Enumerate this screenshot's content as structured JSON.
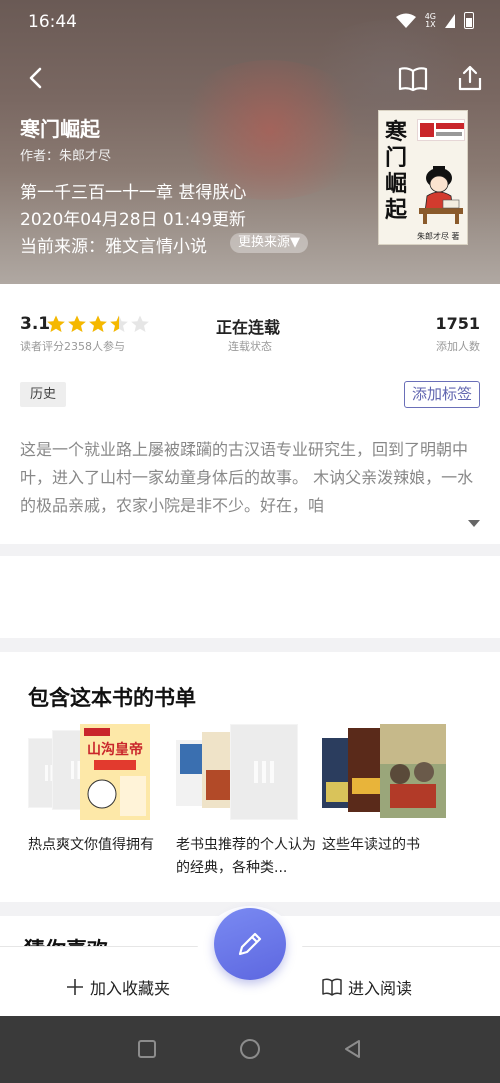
{
  "status_bar": {
    "time": "16:44",
    "network_top": "4G",
    "network_bottom": "1X"
  },
  "book": {
    "title": "寒门崛起",
    "author": "作者：朱郎才尽",
    "latest_chapter": "第一千三百一十一章 甚得朕心",
    "updated_at": "2020年04月28日 01:49更新",
    "source": "当前来源：雅文言情小说",
    "switch_source": "更换来源▼",
    "cover_title_chars": [
      "寒",
      "门",
      "崛",
      "起"
    ],
    "cover_signature": "朱郎才尽 著"
  },
  "stats": {
    "rating": "3.1",
    "stars_filled": 3.5,
    "stars_total": 5,
    "rating_caption": "读者评分2358人参与",
    "status": "正在连载",
    "status_caption": "连载状态",
    "adds": "1751",
    "adds_caption": "添加人数"
  },
  "tags": {
    "history": "历史",
    "add_tag": "添加标签"
  },
  "synopsis": "这是一个就业路上屡被蹂躏的古汉语专业研究生，回到了明朝中叶，进入了山村一家幼童身体后的故事。 木讷父亲泼辣娘，一水的极品亲戚，农家小院是非不少。好在，咱",
  "booklists": {
    "title": "包含这本书的书单",
    "items": [
      {
        "name": "热点爽文你值得拥有"
      },
      {
        "name": "老书虫推荐的个人认为的经典，各种类..."
      },
      {
        "name": "这些年读过的书"
      }
    ]
  },
  "guess": {
    "title": "猜你喜欢"
  },
  "bottom": {
    "add_to_shelf": "加入收藏夹",
    "read": "进入阅读"
  },
  "colors": {
    "accent": "#6166b0",
    "fab": "#6a77e8",
    "star": "#f5b800"
  }
}
